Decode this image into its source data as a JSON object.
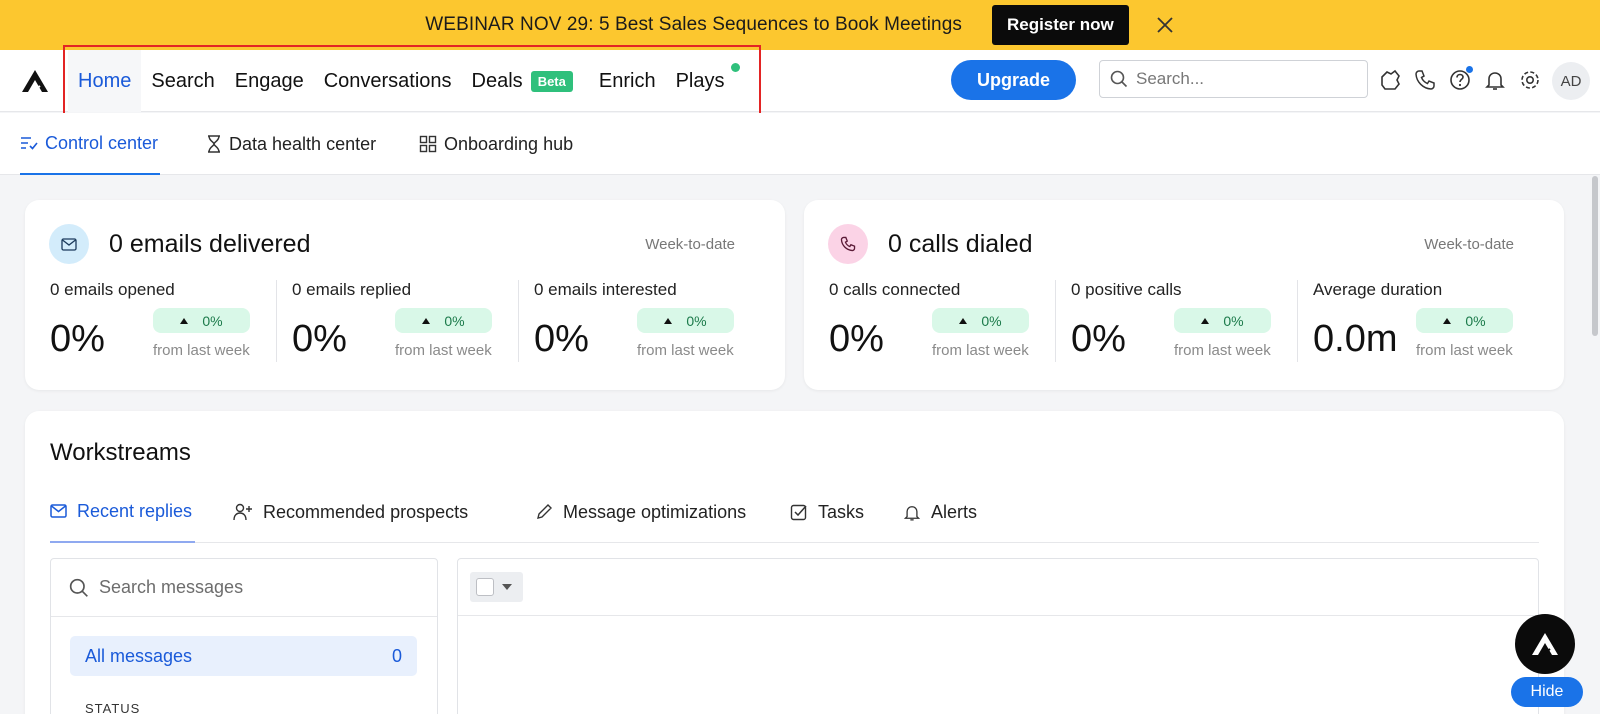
{
  "banner": {
    "text": "WEBINAR NOV 29: 5 Best Sales Sequences to Book Meetings",
    "cta": "Register now",
    "bg_color": "#fcc72f"
  },
  "topnav": {
    "items": [
      {
        "label": "Home",
        "active": true
      },
      {
        "label": "Search"
      },
      {
        "label": "Engage"
      },
      {
        "label": "Conversations"
      },
      {
        "label": "Deals",
        "badge": "Beta"
      },
      {
        "label": "Enrich"
      },
      {
        "label": "Plays",
        "dot": true
      }
    ],
    "upgrade_label": "Upgrade",
    "search_placeholder": "Search...",
    "icons": [
      "puzzle-icon",
      "phone-icon",
      "help-icon",
      "bell-icon",
      "gear-icon"
    ],
    "avatar_initials": "AD",
    "accent_color": "#1a73e8"
  },
  "subnav": {
    "tabs": [
      {
        "label": "Control center",
        "icon": "checklist-icon",
        "active": true
      },
      {
        "label": "Data health center",
        "icon": "hourglass-icon"
      },
      {
        "label": "Onboarding hub",
        "icon": "grid-icon"
      }
    ]
  },
  "email_card": {
    "title": "0 emails delivered",
    "period": "Week-to-date",
    "metrics": [
      {
        "label": "0 emails opened",
        "value": "0%",
        "delta": "0%",
        "delta_sub": "from last week"
      },
      {
        "label": "0 emails replied",
        "value": "0%",
        "delta": "0%",
        "delta_sub": "from last week"
      },
      {
        "label": "0 emails interested",
        "value": "0%",
        "delta": "0%",
        "delta_sub": "from last week"
      }
    ]
  },
  "calls_card": {
    "title": "0 calls dialed",
    "period": "Week-to-date",
    "metrics": [
      {
        "label": "0 calls connected",
        "value": "0%",
        "delta": "0%",
        "delta_sub": "from last week"
      },
      {
        "label": "0 positive calls",
        "value": "0%",
        "delta": "0%",
        "delta_sub": "from last week"
      },
      {
        "label": "Average duration",
        "value": "0.0m",
        "delta": "0%",
        "delta_sub": "from last week"
      }
    ]
  },
  "workstreams": {
    "title": "Workstreams",
    "tabs": [
      {
        "label": "Recent replies",
        "icon": "mail-icon",
        "active": true
      },
      {
        "label": "Recommended prospects",
        "icon": "add-person-icon"
      },
      {
        "label": "Message optimizations",
        "icon": "pencil-icon"
      },
      {
        "label": "Tasks",
        "icon": "checkbox-icon"
      },
      {
        "label": "Alerts",
        "icon": "bell-icon"
      }
    ],
    "search_placeholder": "Search messages",
    "all_messages_label": "All messages",
    "all_messages_count": "0",
    "status_label": "STATUS"
  },
  "widget": {
    "hide_label": "Hide"
  }
}
